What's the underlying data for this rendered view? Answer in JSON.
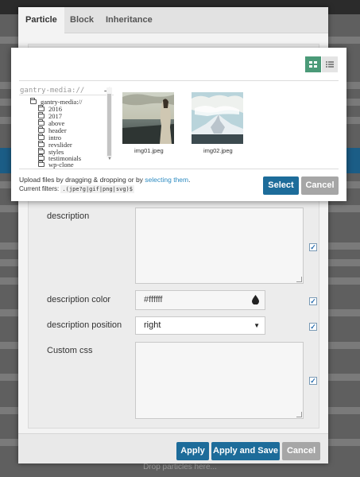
{
  "background": {
    "footer_hint": "Drop particles here..."
  },
  "particle_modal": {
    "tabs": [
      {
        "label": "Particle",
        "active": true
      },
      {
        "label": "Block",
        "active": false
      },
      {
        "label": "Inheritance",
        "active": false
      }
    ],
    "fields": {
      "description": {
        "label": "description",
        "value": "",
        "checked": true
      },
      "description_color": {
        "label": "description color",
        "value": "#ffffff",
        "checked": true
      },
      "description_position": {
        "label": "description position",
        "value": "right",
        "checked": true
      },
      "custom_css": {
        "label": "Custom css",
        "value": "",
        "checked": true
      }
    },
    "footer": {
      "apply_label": "Apply",
      "apply_save_label": "Apply and Save",
      "cancel_label": "Cancel"
    }
  },
  "file_picker": {
    "view_modes": {
      "active": "grid",
      "icons": [
        "grid-icon",
        "list-icon"
      ]
    },
    "tree": {
      "root": "gantry-media://",
      "collapse_glyph": "–",
      "top_folder": "gantry-media://",
      "folders": [
        "2016",
        "2017",
        "above",
        "header",
        "intro",
        "revslider",
        "styles",
        "testimonials",
        "wp-clone"
      ]
    },
    "files": [
      {
        "name": "img01.jpeg",
        "icon": "image-thumbnail"
      },
      {
        "name": "img02.jpeg",
        "icon": "image-thumbnail"
      }
    ],
    "upload": {
      "text": "Upload files by dragging & dropping or by ",
      "link": "selecting them",
      "text_end": "."
    },
    "filters": {
      "label": "Current filters:",
      "value": ".(jpe?g|gif|png|svg)$"
    },
    "select_label": "Select",
    "cancel_label": "Cancel"
  },
  "colors": {
    "accent_blue": "#1d6c9a",
    "accent_green": "#4b9a78",
    "disabled_grey": "#a6a6a6"
  }
}
